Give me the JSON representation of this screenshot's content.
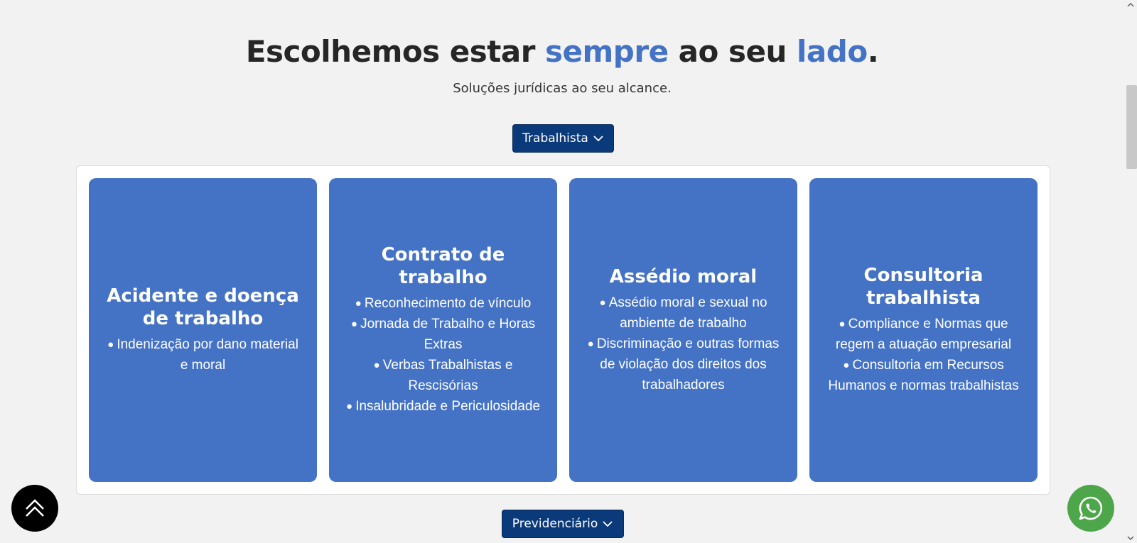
{
  "headline": {
    "part1": "Escolhemos estar ",
    "accent1": "sempre",
    "part2": " ao seu ",
    "accent2": "lado",
    "part3": "."
  },
  "subtitle": "Soluções jurídicas ao seu alcance.",
  "dropdowns": {
    "trabalhista": "Trabalhista",
    "previdenciario": "Previdenciário"
  },
  "cards": [
    {
      "title": "Acidente e doença de trabalho",
      "items": [
        "Indenização por dano material e moral"
      ]
    },
    {
      "title": "Contrato de trabalho",
      "items": [
        "Reconhecimento de vínculo",
        "Jornada de Trabalho e Horas Extras",
        "Verbas Trabalhistas e Rescisórias",
        "Insalubridade e Periculosidade"
      ]
    },
    {
      "title": "Assédio moral",
      "items": [
        "Assédio moral e sexual no ambiente de trabalho",
        "Discriminação e outras formas de violação dos direitos dos trabalhadores"
      ]
    },
    {
      "title": "Consultoria trabalhista",
      "items": [
        "Compliance e Normas que regem a atuação empresarial",
        "Consultoria em Recursos Humanos e normas trabalhistas"
      ]
    }
  ],
  "icons": {
    "scroll_top": "double-chevron-up-icon",
    "whatsapp": "whatsapp-icon",
    "dropdown": "chevron-down-icon"
  },
  "colors": {
    "accent": "#4472c4",
    "button": "#0b3a7a",
    "whatsapp": "#4ea64a"
  }
}
